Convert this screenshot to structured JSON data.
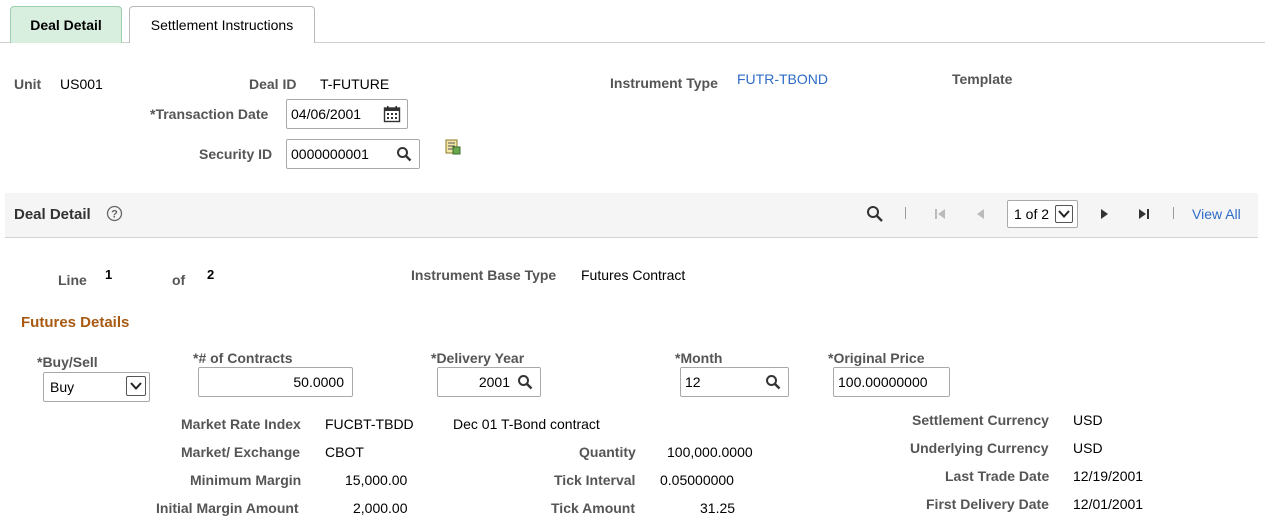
{
  "tabs": [
    {
      "label": "Deal Detail",
      "active": true
    },
    {
      "label": "Settlement Instructions",
      "active": false
    }
  ],
  "header": {
    "unit_label": "Unit",
    "unit_value": "US001",
    "deal_id_label": "Deal ID",
    "deal_id_value": "T-FUTURE",
    "instrument_type_label": "Instrument Type",
    "instrument_type_value": "FUTR-TBOND",
    "template_label": "Template",
    "transaction_date_label": "*Transaction Date",
    "transaction_date_value": "04/06/2001",
    "security_id_label": "Security ID",
    "security_id_value": "0000000001"
  },
  "grid": {
    "title": "Deal Detail",
    "pager_value": "1 of 2",
    "view_all": "View All"
  },
  "line": {
    "line_label": "Line",
    "line_value": "1",
    "of_label": "of",
    "of_value": "2",
    "base_type_label": "Instrument Base Type",
    "base_type_value": "Futures Contract"
  },
  "futures": {
    "section_title": "Futures Details",
    "buy_sell_label": "*Buy/Sell",
    "buy_sell_value": "Buy",
    "contracts_label": "*# of Contracts",
    "contracts_value": "50.0000",
    "delivery_year_label": "*Delivery Year",
    "delivery_year_value": "2001",
    "month_label": "*Month",
    "month_value": "12",
    "original_price_label": "*Original Price",
    "original_price_value": "100.00000000",
    "market_rate_index_label": "Market Rate Index",
    "market_rate_index_value": "FUCBT-TBDD",
    "market_rate_index_desc": "Dec 01 T-Bond contract",
    "market_exchange_label": "Market/ Exchange",
    "market_exchange_value": "CBOT",
    "minimum_margin_label": "Minimum Margin",
    "minimum_margin_value": "15,000.00",
    "initial_margin_label": "Initial Margin Amount",
    "initial_margin_value": "2,000.00",
    "quantity_label": "Quantity",
    "quantity_value": "100,000.0000",
    "tick_interval_label": "Tick Interval",
    "tick_interval_value": "0.05000000",
    "tick_amount_label": "Tick Amount",
    "tick_amount_value": "31.25",
    "settlement_currency_label": "Settlement Currency",
    "settlement_currency_value": "USD",
    "underlying_currency_label": "Underlying Currency",
    "underlying_currency_value": "USD",
    "last_trade_date_label": "Last Trade Date",
    "last_trade_date_value": "12/19/2001",
    "first_delivery_date_label": "First Delivery Date",
    "first_delivery_date_value": "12/01/2001"
  },
  "colors": {
    "active_tab_bg": "#d8efe0",
    "link": "#2e6cc7",
    "section_title": "#a85a13"
  }
}
